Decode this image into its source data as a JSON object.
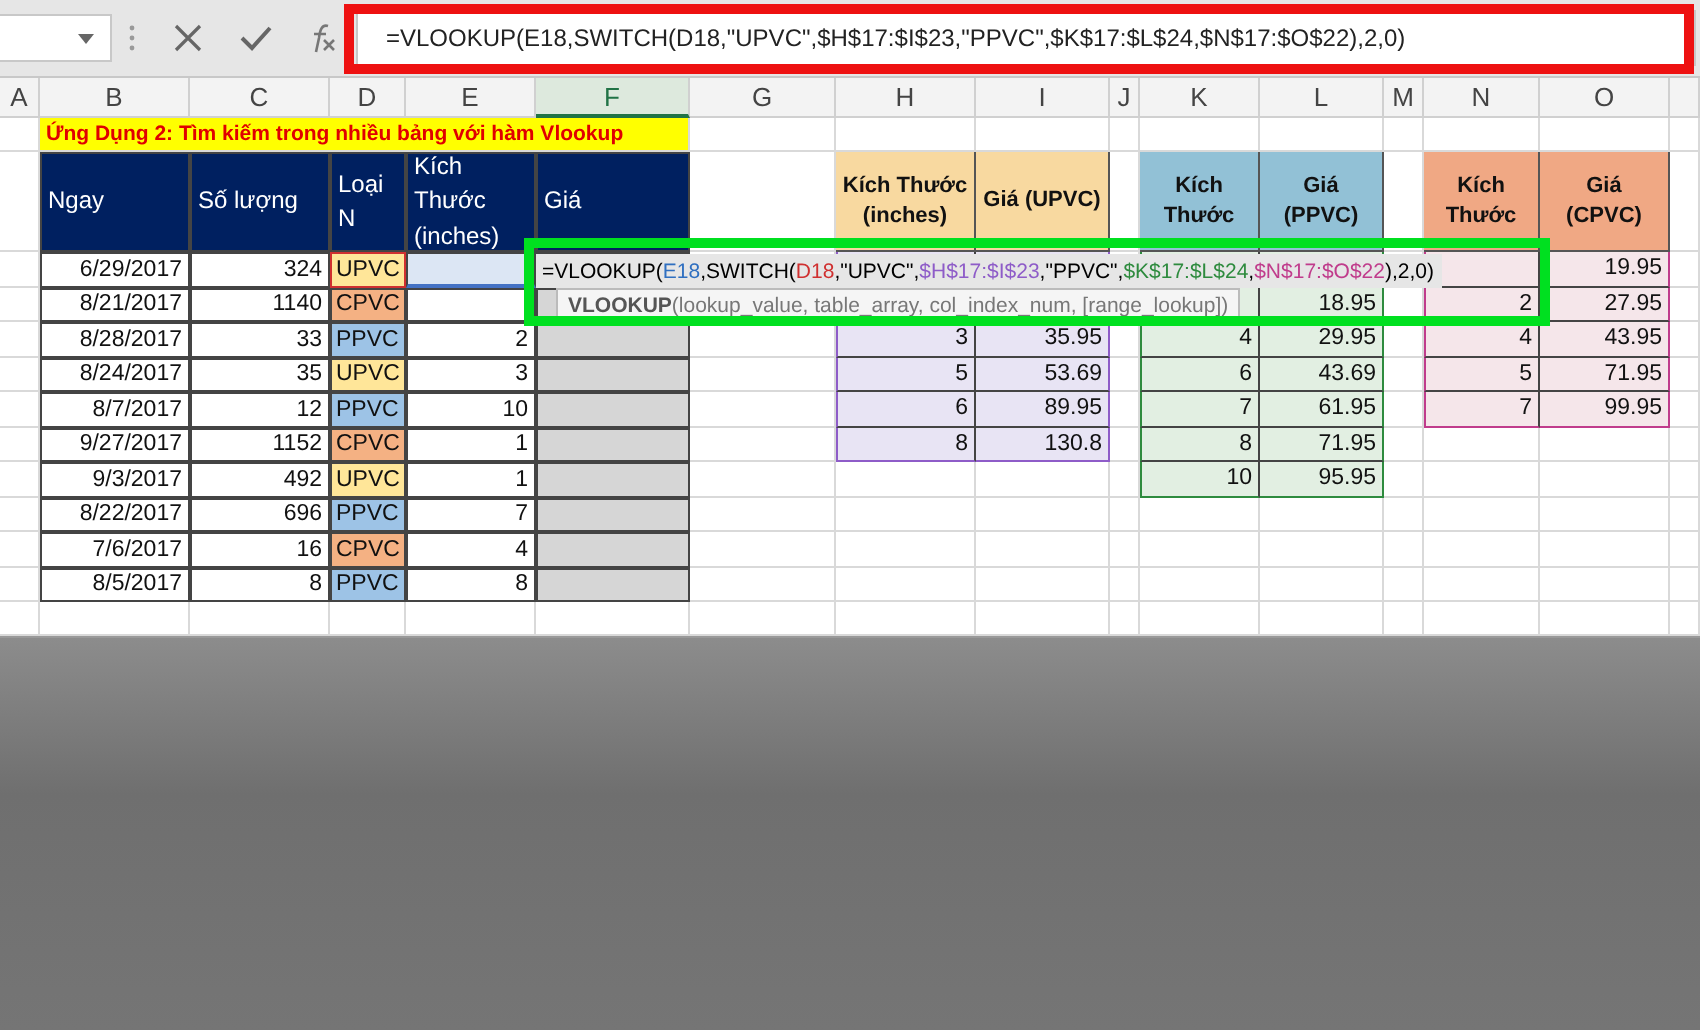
{
  "formula_bar": {
    "formula": "=VLOOKUP(E18,SWITCH(D18,\"UPVC\",$H$17:$I$23,\"PPVC\",$K$17:$L$24,$N$17:$O$22),2,0)"
  },
  "column_headers": [
    "A",
    "B",
    "C",
    "D",
    "E",
    "F",
    "G",
    "H",
    "I",
    "J",
    "K",
    "L",
    "M",
    "N",
    "O"
  ],
  "title": "Ứng Dụng 2: Tìm kiếm trong nhiều bảng với hàm Vlookup",
  "main_table": {
    "columns": [
      "Ngay",
      "Số lượng",
      "Loại N",
      "Kích Thước (inches)",
      "Giá"
    ],
    "rows": [
      {
        "date": "6/29/2017",
        "quantity": "324",
        "type": "UPVC",
        "color": "#ffe699",
        "selected": true
      },
      {
        "date": "8/21/2017",
        "quantity": "1140",
        "type": "CPVC",
        "color": "#f4b183",
        "selected": false
      },
      {
        "date": "8/28/2017",
        "quantity": "33",
        "type": "PPVC",
        "color": "#9dc3e6",
        "size": "2",
        "selected": false
      },
      {
        "date": "8/24/2017",
        "quantity": "35",
        "type": "UPVC",
        "color": "#ffe699",
        "size": "3",
        "selected": false
      },
      {
        "date": "8/7/2017",
        "quantity": "12",
        "type": "PPVC",
        "color": "#9dc3e6",
        "size": "10",
        "selected": false
      },
      {
        "date": "9/27/2017",
        "quantity": "1152",
        "type": "CPVC",
        "color": "#f4b183",
        "size": "1",
        "selected": false
      },
      {
        "date": "9/3/2017",
        "quantity": "492",
        "type": "UPVC",
        "color": "#ffe699",
        "size": "1",
        "selected": false
      },
      {
        "date": "8/22/2017",
        "quantity": "696",
        "type": "PPVC",
        "color": "#9dc3e6",
        "size": "7",
        "selected": false
      },
      {
        "date": "7/6/2017",
        "quantity": "16",
        "type": "CPVC",
        "color": "#f4b183",
        "size": "4",
        "selected": false
      },
      {
        "date": "8/5/2017",
        "quantity": "8",
        "type": "PPVC",
        "color": "#9dc3e6",
        "size": "8",
        "selected": false
      }
    ]
  },
  "lookup_tables": [
    {
      "columns": [
        "Kích Thước (inches)",
        "Giá (UPVC)"
      ],
      "rows": [
        {},
        {},
        {
          "size": "3",
          "price": "35.95"
        },
        {
          "size": "5",
          "price": "53.69"
        },
        {
          "size": "6",
          "price": "89.95"
        },
        {
          "size": "8",
          "price": "130.8"
        }
      ]
    },
    {
      "columns": [
        "Kích Thước",
        "Giá (PPVC)"
      ],
      "rows": [
        {},
        {
          "price": "18.95"
        },
        {
          "size": "4",
          "price": "29.95"
        },
        {
          "size": "6",
          "price": "43.69"
        },
        {
          "size": "7",
          "price": "61.95"
        },
        {
          "size": "8",
          "price": "71.95"
        },
        {
          "size": "10",
          "price": "95.95"
        }
      ]
    },
    {
      "columns": [
        "Kích Thước",
        "Giá (CPVC)"
      ],
      "rows": [
        {
          "price": "19.95"
        },
        {
          "size": "2",
          "price": "27.95"
        },
        {
          "size": "4",
          "price": "43.95"
        },
        {
          "size": "5",
          "price": "71.95"
        },
        {
          "size": "7",
          "price": "99.95"
        }
      ]
    }
  ],
  "cell_editor": {
    "segments": [
      {
        "text": "=VLOOKUP(",
        "color": "#000000"
      },
      {
        "text": "E18",
        "color": "#2f6fc0"
      },
      {
        "text": ",SWITCH(",
        "color": "#000000"
      },
      {
        "text": "D18",
        "color": "#d03030"
      },
      {
        "text": ",\"UPVC\",",
        "color": "#000000"
      },
      {
        "text": "$H$17:$I$23",
        "color": "#8e5cc8"
      },
      {
        "text": ",\"PPVC\",",
        "color": "#000000"
      },
      {
        "text": "$K$17:$L$24",
        "color": "#2e8b3e"
      },
      {
        "text": ",",
        "color": "#000000"
      },
      {
        "text": "$N$17:$O$22",
        "color": "#c03c8c"
      },
      {
        "text": "),2,0)",
        "color": "#000000"
      }
    ],
    "tooltip": "**VLOOKUP**(lookup_value, table_array, col_index_num, [range_lookup])"
  }
}
